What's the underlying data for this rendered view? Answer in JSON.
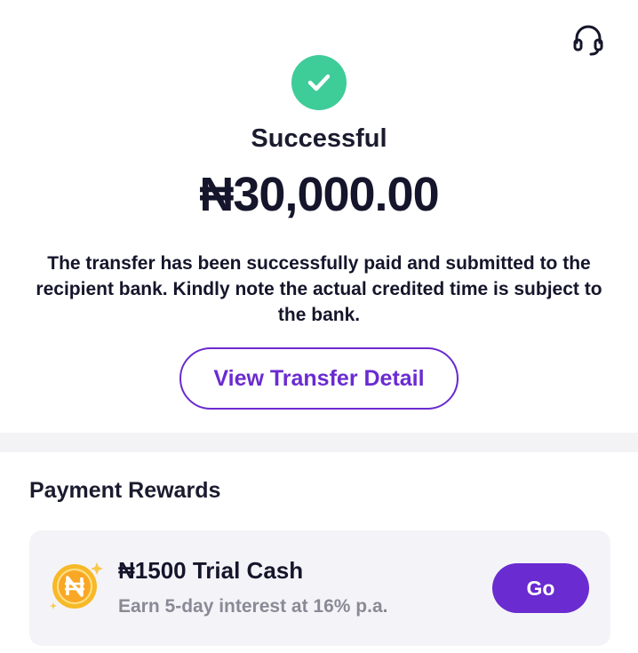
{
  "status": {
    "title": "Successful",
    "amount": "₦30,000.00",
    "message": "The transfer has been successfully paid and submitted to the recipient bank. Kindly note the actual credited time is subject to the bank.",
    "icon": "checkmark-icon",
    "color": "#3ecc98"
  },
  "header": {
    "support_icon": "headset-icon"
  },
  "actions": {
    "view_detail_label": "View Transfer Detail"
  },
  "rewards": {
    "section_title": "Payment Rewards",
    "items": [
      {
        "icon": "naira-coin-icon",
        "title": "₦1500 Trial Cash",
        "subtitle": "Earn 5-day interest at 16% p.a.",
        "button_label": "Go"
      }
    ]
  },
  "colors": {
    "accent": "#6a2bd0",
    "success": "#3ecc98",
    "coin": "#f7b928",
    "text": "#15152b",
    "muted": "#8a8a96"
  }
}
